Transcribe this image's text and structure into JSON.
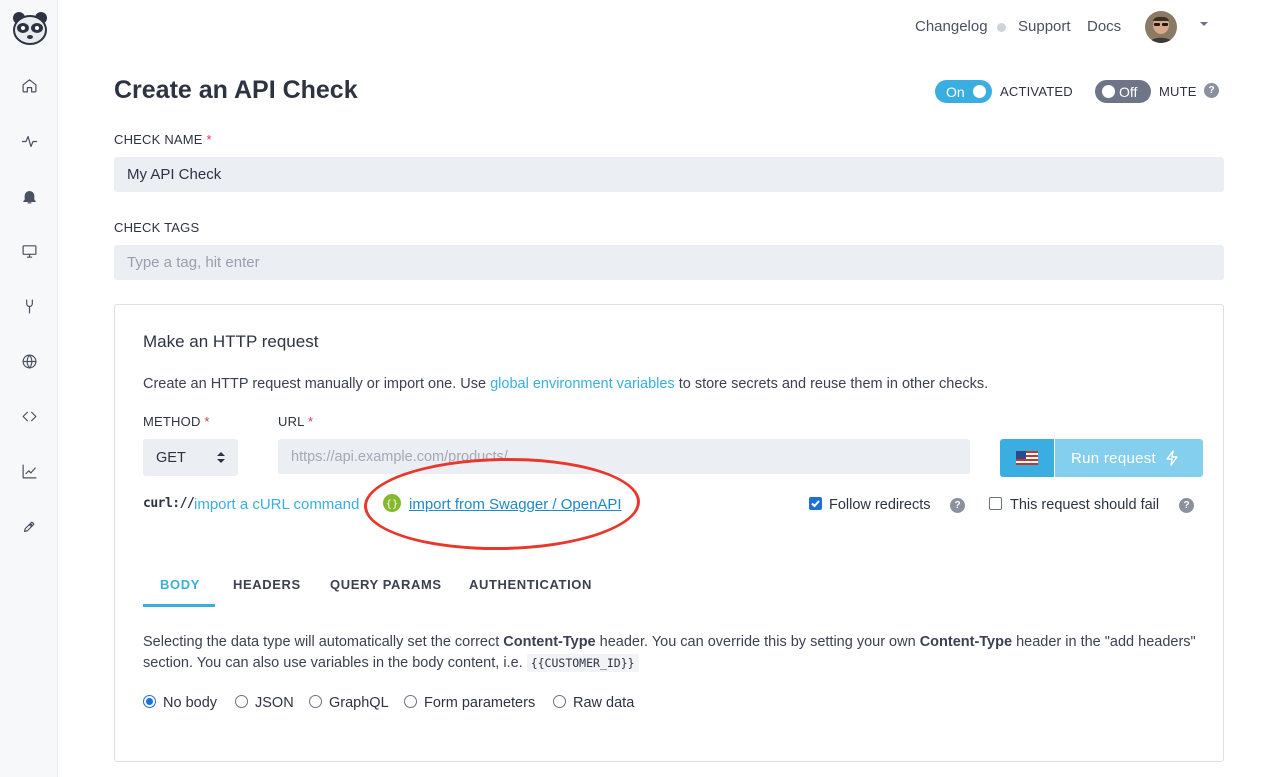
{
  "topnav": {
    "changelog": "Changelog",
    "support": "Support",
    "docs": "Docs"
  },
  "sidebar": {
    "items": [
      {
        "icon": "home-icon"
      },
      {
        "icon": "activity-icon"
      },
      {
        "icon": "bell-icon"
      },
      {
        "icon": "monitor-icon"
      },
      {
        "icon": "wrench-icon"
      },
      {
        "icon": "globe-icon"
      },
      {
        "icon": "code-icon"
      },
      {
        "icon": "chart-icon"
      },
      {
        "icon": "rocket-icon"
      }
    ]
  },
  "header": {
    "title": "Create an API Check",
    "activated_toggle": "On",
    "activated_label": "ACTIVATED",
    "mute_toggle": "Off",
    "mute_label": "MUTE",
    "help": "?"
  },
  "form": {
    "check_name_label": "CHECK NAME",
    "required_mark": "*",
    "check_name_value": "My API Check",
    "check_tags_label": "CHECK TAGS",
    "check_tags_placeholder": "Type a tag, hit enter"
  },
  "request": {
    "title": "Make an HTTP request",
    "desc_prefix": "Create an HTTP request manually or import one. Use ",
    "desc_link": "global environment variables",
    "desc_suffix": " to store secrets and reuse them in other checks.",
    "method_label": "METHOD",
    "method_value": "GET",
    "url_label": "URL",
    "url_placeholder": "https://api.example.com/products/",
    "run_label": "Run request",
    "curl_logo": "curl://",
    "import_curl": "import a cURL command",
    "import_swagger": "import from Swagger / OpenAPI",
    "follow_redirects": "Follow redirects",
    "follow_redirects_checked": true,
    "should_fail": "This request should fail",
    "should_fail_checked": false
  },
  "tabs": [
    {
      "label": "BODY",
      "active": true
    },
    {
      "label": "HEADERS",
      "active": false
    },
    {
      "label": "QUERY PARAMS",
      "active": false
    },
    {
      "label": "AUTHENTICATION",
      "active": false
    }
  ],
  "body_section": {
    "desc_1": "Selecting the data type will automatically set the correct ",
    "bold_1": "Content-Type",
    "desc_2": " header. You can override this by setting your own ",
    "bold_2": "Content-Type",
    "desc_3": " header in the \"add headers\" section. You can also use variables in the body content, i.e. ",
    "code": "{{CUSTOMER_ID}}",
    "options": [
      {
        "label": "No body",
        "selected": true
      },
      {
        "label": "JSON",
        "selected": false
      },
      {
        "label": "GraphQL",
        "selected": false
      },
      {
        "label": "Form parameters",
        "selected": false
      },
      {
        "label": "Raw data",
        "selected": false
      }
    ]
  },
  "colors": {
    "accent": "#3aaee0",
    "required": "#e0364a",
    "annotation": "#e8372b"
  }
}
